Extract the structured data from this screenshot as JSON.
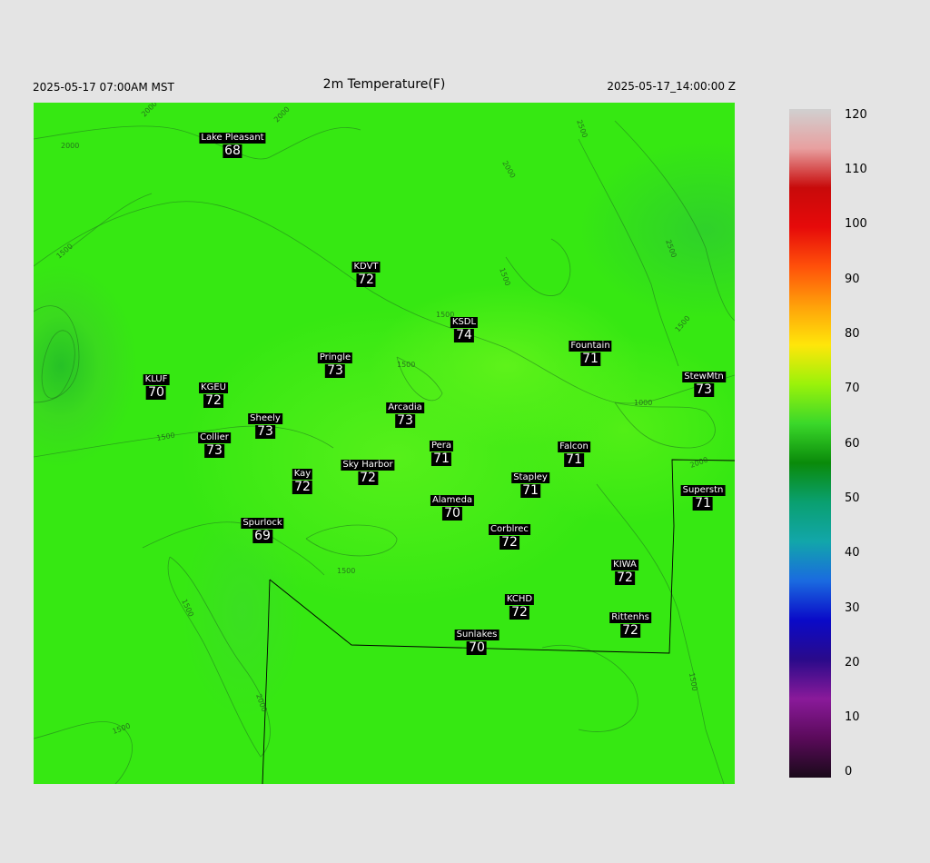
{
  "header": {
    "valid_local": "2025-05-17 07:00AM MST",
    "title": "2m Temperature(F)",
    "valid_utc": "2025-05-17_14:00:00 Z"
  },
  "stations": [
    {
      "name": "Lake Pleasant",
      "value": "68"
    },
    {
      "name": "KDVT",
      "value": "72"
    },
    {
      "name": "KSDL",
      "value": "74"
    },
    {
      "name": "Fountain",
      "value": "71"
    },
    {
      "name": "Pringle",
      "value": "73"
    },
    {
      "name": "KLUF",
      "value": "70"
    },
    {
      "name": "KGEU",
      "value": "72"
    },
    {
      "name": "StewMtn",
      "value": "73"
    },
    {
      "name": "Arcadia",
      "value": "73"
    },
    {
      "name": "Sheely",
      "value": "73"
    },
    {
      "name": "Collier",
      "value": "73"
    },
    {
      "name": "Pera",
      "value": "71"
    },
    {
      "name": "Falcon",
      "value": "71"
    },
    {
      "name": "Kay",
      "value": "72"
    },
    {
      "name": "Sky Harbor",
      "value": "72"
    },
    {
      "name": "Stapley",
      "value": "71"
    },
    {
      "name": "Superstn",
      "value": "71"
    },
    {
      "name": "Alameda",
      "value": "70"
    },
    {
      "name": "Spurlock",
      "value": "69"
    },
    {
      "name": "Corblrec",
      "value": "72"
    },
    {
      "name": "KIWA",
      "value": "72"
    },
    {
      "name": "KCHD",
      "value": "72"
    },
    {
      "name": "Rittenhs",
      "value": "72"
    },
    {
      "name": "Sunlakes",
      "value": "70"
    }
  ],
  "contour_labels": [
    "2000",
    "2000",
    "2000",
    "1500",
    "1500",
    "2500",
    "2500",
    "2000",
    "1500",
    "1500",
    "1500",
    "1000",
    "1500",
    "1500",
    "2000",
    "1500",
    "2000",
    "1500",
    "1500"
  ],
  "colorbar": {
    "ticks": [
      "120",
      "110",
      "100",
      "90",
      "80",
      "70",
      "60",
      "50",
      "40",
      "30",
      "20",
      "10",
      "0"
    ],
    "colors": [
      "#1a0a1a",
      "#5a0a5a",
      "#8a1a9a",
      "#2a0a8a",
      "#0a0ac8",
      "#1a6ae0",
      "#12a6aa",
      "#0aa070",
      "#0a8a0a",
      "#3ad82a",
      "#9af20a",
      "#ffe60a",
      "#ffa00a",
      "#ff500a",
      "#e60a0a",
      "#c80a0a",
      "#e8a0a0",
      "#d0d0d0"
    ]
  }
}
